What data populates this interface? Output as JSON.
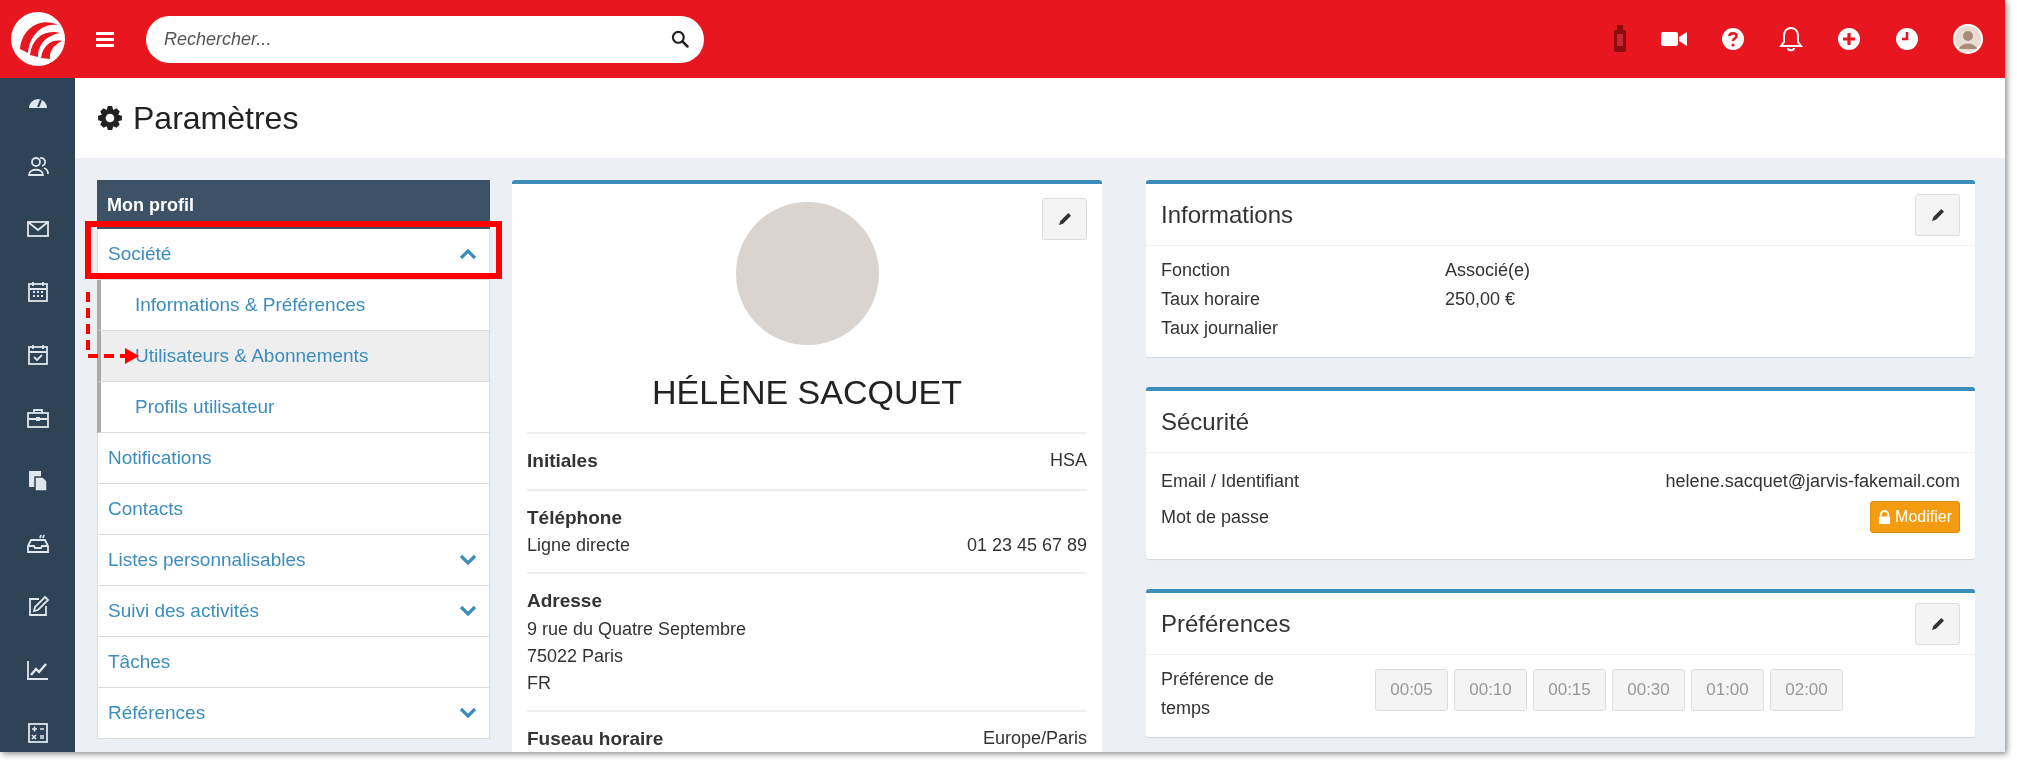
{
  "topbar": {
    "search": {
      "placeholder": "Rechercher..."
    }
  },
  "page_title": "Paramètres",
  "settings_menu": {
    "header": "Mon profil",
    "items": [
      {
        "label": "Société",
        "kind": "group",
        "expanded": true,
        "highlighted": true,
        "children": [
          {
            "label": "Informations & Préférences",
            "selected": false,
            "arrow": false
          },
          {
            "label": "Utilisateurs & Abonnements",
            "selected": true,
            "arrow": true
          },
          {
            "label": "Profils utilisateur",
            "selected": false,
            "arrow": false
          }
        ]
      },
      {
        "label": "Notifications",
        "kind": "link",
        "highlighted": false
      },
      {
        "label": "Contacts",
        "kind": "link",
        "highlighted": false
      },
      {
        "label": "Listes personnalisables",
        "kind": "group",
        "expanded": false,
        "highlighted": false
      },
      {
        "label": "Suivi des activités",
        "kind": "group",
        "expanded": false,
        "highlighted": false
      },
      {
        "label": "Tâches",
        "kind": "link",
        "highlighted": false
      },
      {
        "label": "Références",
        "kind": "group",
        "expanded": false,
        "highlighted": false
      }
    ]
  },
  "profile": {
    "name": "HÉLÈNE SACQUET",
    "fields": [
      {
        "heading": "Initiales",
        "value": "HSA"
      },
      {
        "heading": "Téléphone",
        "rows": [
          {
            "label": "Ligne directe",
            "value": "01 23 45 67 89"
          }
        ]
      },
      {
        "heading": "Adresse",
        "lines": [
          "9 rue du Quatre Septembre",
          "75022 Paris",
          "FR"
        ]
      },
      {
        "heading": "Fuseau horaire",
        "value": "Europe/Paris"
      }
    ]
  },
  "informations": {
    "title": "Informations",
    "rows": [
      {
        "label": "Fonction",
        "value": "Associé(e)"
      },
      {
        "label": "Taux horaire",
        "value": "250,00 €"
      },
      {
        "label": "Taux journalier"
      }
    ]
  },
  "securite": {
    "title": "Sécurité",
    "rows": [
      {
        "label": "Email / Identifiant",
        "value": "helene.sacquet@jarvis-fakemail.com"
      },
      {
        "label": "Mot de passe",
        "button": "Modifier"
      }
    ]
  },
  "preferences": {
    "title": "Préférences",
    "label": "Préférence de temps",
    "options": [
      {
        "label": "00:05",
        "selected": false
      },
      {
        "label": "00:10",
        "selected": false
      },
      {
        "label": "00:15",
        "selected": false
      },
      {
        "label": "00:30",
        "selected": false
      },
      {
        "label": "01:00",
        "selected": false
      },
      {
        "label": "02:00",
        "selected": false
      }
    ]
  }
}
